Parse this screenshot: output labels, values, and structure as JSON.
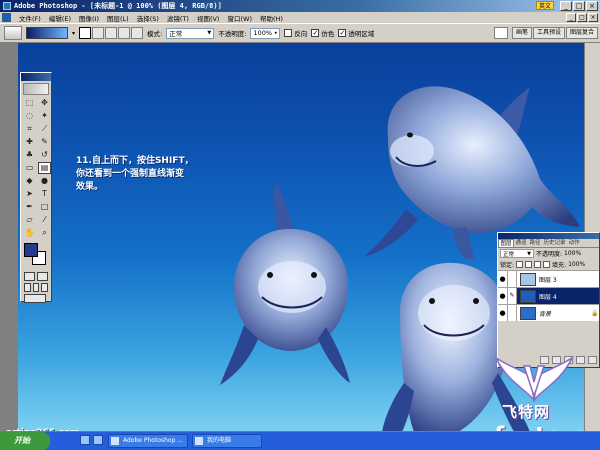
{
  "window": {
    "title": "Adobe Photoshop - [未标题-1 @ 100% (图层 4, RGB/8)]",
    "ime_indicator": "英文",
    "controls": [
      "_",
      "□",
      "×"
    ],
    "doc_controls": [
      "_",
      "□",
      "×"
    ]
  },
  "menu": [
    "文件(F)",
    "编辑(E)",
    "图像(I)",
    "图层(L)",
    "选择(S)",
    "滤镜(T)",
    "视图(V)",
    "窗口(W)",
    "帮助(H)"
  ],
  "options_bar": {
    "mode_label": "模式:",
    "mode_value": "正常",
    "opacity_label": "不透明度:",
    "opacity_value": "100%",
    "reverse_label": "反向",
    "reverse_checked": false,
    "dither_label": "仿色",
    "dither_checked": true,
    "transparency_label": "透明区域",
    "transparency_checked": true,
    "palette_tabs": [
      "画笔",
      "工具预设",
      "图层复合"
    ]
  },
  "instruction": {
    "lines": [
      "11.自上而下，按住SHIFT，",
      "你还看到一个强制直线渐变",
      "效果。"
    ]
  },
  "layers_panel": {
    "tabs": [
      "图层",
      "通道",
      "路径",
      "历史记录",
      "动作"
    ],
    "blend_mode": "正常",
    "opacity_label": "不透明度:",
    "opacity_value": "100%",
    "lock_label": "锁定:",
    "fill_label": "填充:",
    "fill_value": "100%",
    "layers": [
      {
        "name": "图层 3",
        "visible": true,
        "selected": false,
        "thumb_color": "#a7c6e6"
      },
      {
        "name": "图层 4",
        "visible": true,
        "selected": true,
        "thumb_color": "#1f5fb8"
      },
      {
        "name": "背景",
        "visible": true,
        "selected": false,
        "thumb_color": "#2b6ec4"
      }
    ]
  },
  "watermark": {
    "site_name": "飞特网",
    "url": "fevte.com",
    "left_url": "artina365.com"
  },
  "taskbar": {
    "start_label": "开始",
    "tasks": [
      "Adobe Photoshop ...",
      "我的电脑"
    ]
  },
  "colors": {
    "foreground": "#253a8a",
    "background": "#ffffff",
    "gradient_start": "#0b1c66",
    "gradient_end": "#6fb7ff"
  }
}
